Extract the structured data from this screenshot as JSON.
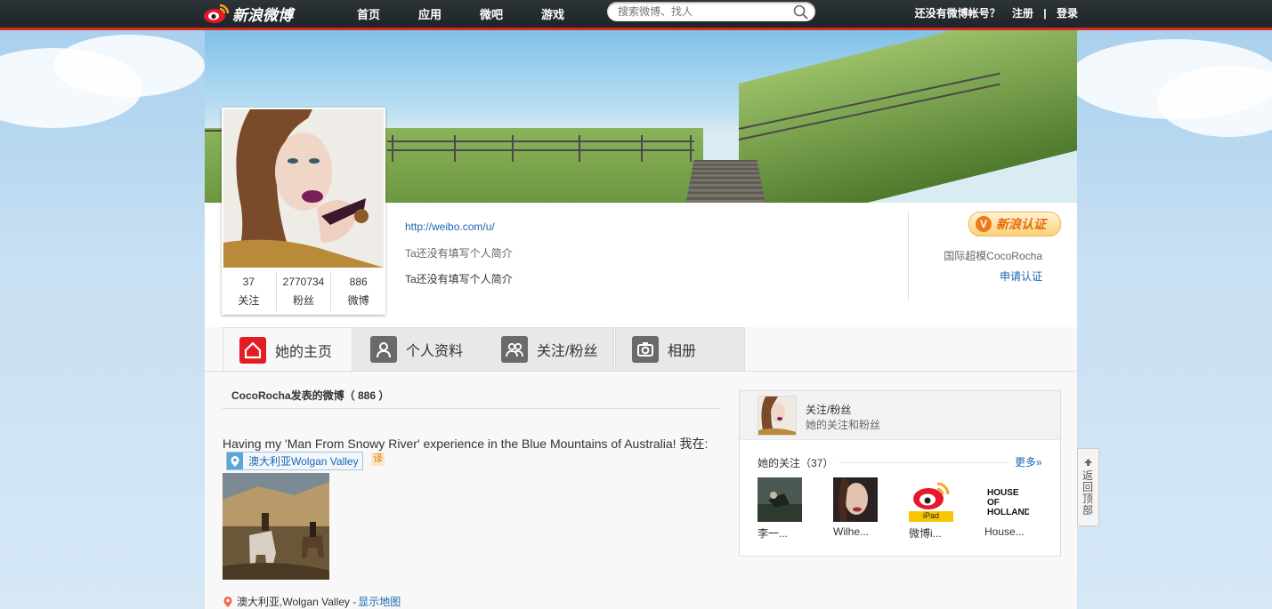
{
  "topnav": {
    "logo_text": "新浪微博",
    "items": [
      "首页",
      "应用",
      "微吧",
      "游戏"
    ],
    "search_placeholder": "搜索微博、找人",
    "no_account": "还没有微博帐号？",
    "register": "注册",
    "separator": "|",
    "login": "登录"
  },
  "profile": {
    "url": "http://weibo.com/u/",
    "bio_placeholder": "Ta还没有填写个人简介",
    "bio": "Ta还没有填写个人简介",
    "stats": [
      {
        "value": "37",
        "label": "关注"
      },
      {
        "value": "2770734",
        "label": "粉丝"
      },
      {
        "value": "886",
        "label": "微博"
      }
    ],
    "verify_badge_letter": "V",
    "verify_badge_label": "新浪认证",
    "verify_desc": "国际超模CocoRocha",
    "verify_apply": "申请认证"
  },
  "tabs": [
    {
      "label": "她的主页",
      "icon": "home-icon",
      "active": true
    },
    {
      "label": "个人资料",
      "icon": "profile-icon",
      "active": false
    },
    {
      "label": "关注/粉丝",
      "icon": "users-icon",
      "active": false
    },
    {
      "label": "相册",
      "icon": "camera-icon",
      "active": false
    }
  ],
  "feed": {
    "title": "CocoRocha发表的微博（ 886 ）",
    "post_text": "Having my 'Man From Snowy River' experience in the Blue Mountains of Australia! 我在:",
    "location_chip": "澳大利亚Wolgan Valley",
    "translate": "译",
    "location_line": "澳大利亚,Wolgan Valley -",
    "map_link": "显示地图"
  },
  "side": {
    "title": "关注/粉丝",
    "subtitle": "她的关注和粉丝",
    "following_label": "她的关注（37）",
    "more": "更多»",
    "following": [
      {
        "name": "李一..."
      },
      {
        "name": "Wilhe..."
      },
      {
        "name": "微博i..."
      },
      {
        "name": "House..."
      }
    ],
    "ipad_label": "iPad",
    "house_logo": "HOUSE OF HOLLAND"
  },
  "backtop": {
    "label": "返回顶部"
  },
  "colors": {
    "accent_red": "#e41d25",
    "link_blue": "#1a66b3",
    "nav_bg": "#1e2427"
  }
}
